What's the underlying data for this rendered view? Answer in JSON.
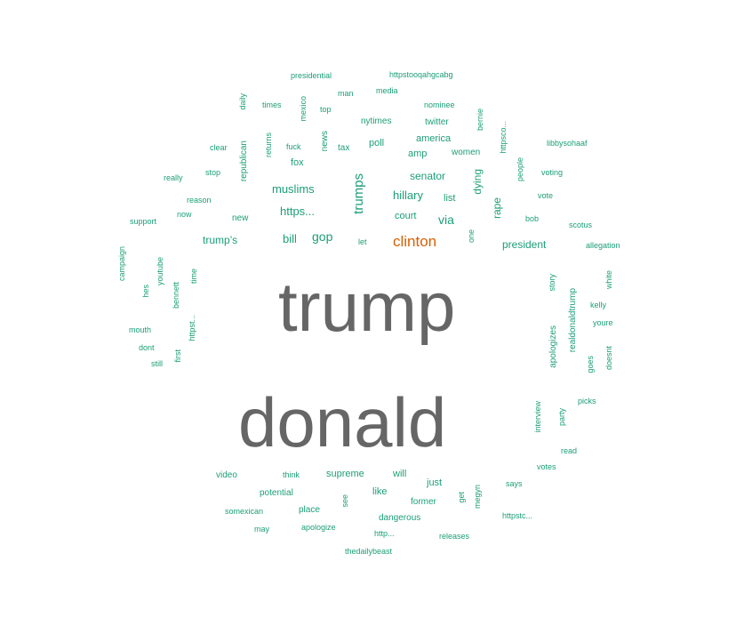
{
  "colors": {
    "main": "#666666",
    "accent": "#d95f02",
    "word": "#1b9e77"
  },
  "words": {
    "trump": "trump",
    "donald": "donald",
    "clinton": "clinton",
    "trumps": "trumps",
    "muslims": "muslims",
    "https_dots": "https...",
    "gop": "gop",
    "bill": "bill",
    "trumps_apos": "trump’s",
    "hillary": "hillary",
    "senator": "senator",
    "via": "via",
    "court": "court",
    "president": "president",
    "rape": "rape",
    "dying": "dying",
    "list": "list",
    "america": "america",
    "amp": "amp",
    "women": "women",
    "poll": "poll",
    "nytimes": "nytimes",
    "twitter": "twitter",
    "nominee": "nominee",
    "bernie": "bernie",
    "media": "media",
    "man": "man",
    "top": "top",
    "presidential": "presidential",
    "httpstooqahgcabg": "httpstooqahgcabg",
    "times": "times",
    "daily": "daily",
    "mexico": "mexico",
    "news": "news",
    "tax": "tax",
    "fuck": "fuck",
    "fox": "fox",
    "returns": "returns",
    "republican": "republican",
    "clear": "clear",
    "stop": "stop",
    "really": "really",
    "reason": "reason",
    "now": "now",
    "new": "new",
    "support": "support",
    "httpsco": "httpsco...",
    "libbysohaaf": "libbysohaaf",
    "people": "people",
    "voting": "voting",
    "vote": "vote",
    "bob": "bob",
    "scotus": "scotus",
    "allegation": "allegation",
    "one": "one",
    "let": "let",
    "campaign": "campaign",
    "hes": "hes",
    "youtube": "youtube",
    "bennett": "bennett",
    "time": "time",
    "mouth": "mouth",
    "dont": "dont",
    "still": "still",
    "first": "first",
    "httpst": "httpst...",
    "story": "story",
    "realdonaldtrump": "realdonaldtrump",
    "white": "white",
    "kelly": "kelly",
    "youre": "youre",
    "apologizes": "apologizes",
    "goes": "goes",
    "doesnt": "doesnt",
    "interview": "interview",
    "party": "party",
    "picks": "picks",
    "read": "read",
    "votes": "votes",
    "says": "says",
    "httpstc": "httpstc...",
    "video": "video",
    "think": "think",
    "supreme": "supreme",
    "will": "will",
    "just": "just",
    "potential": "potential",
    "like": "like",
    "see": "see",
    "get": "get",
    "megyn": "megyn",
    "somexican": "somexican",
    "place": "place",
    "former": "former",
    "dangerous": "dangerous",
    "may": "may",
    "apologize": "apologize",
    "http": "http...",
    "releases": "releases",
    "thedailybeast": "thedailybeast"
  }
}
